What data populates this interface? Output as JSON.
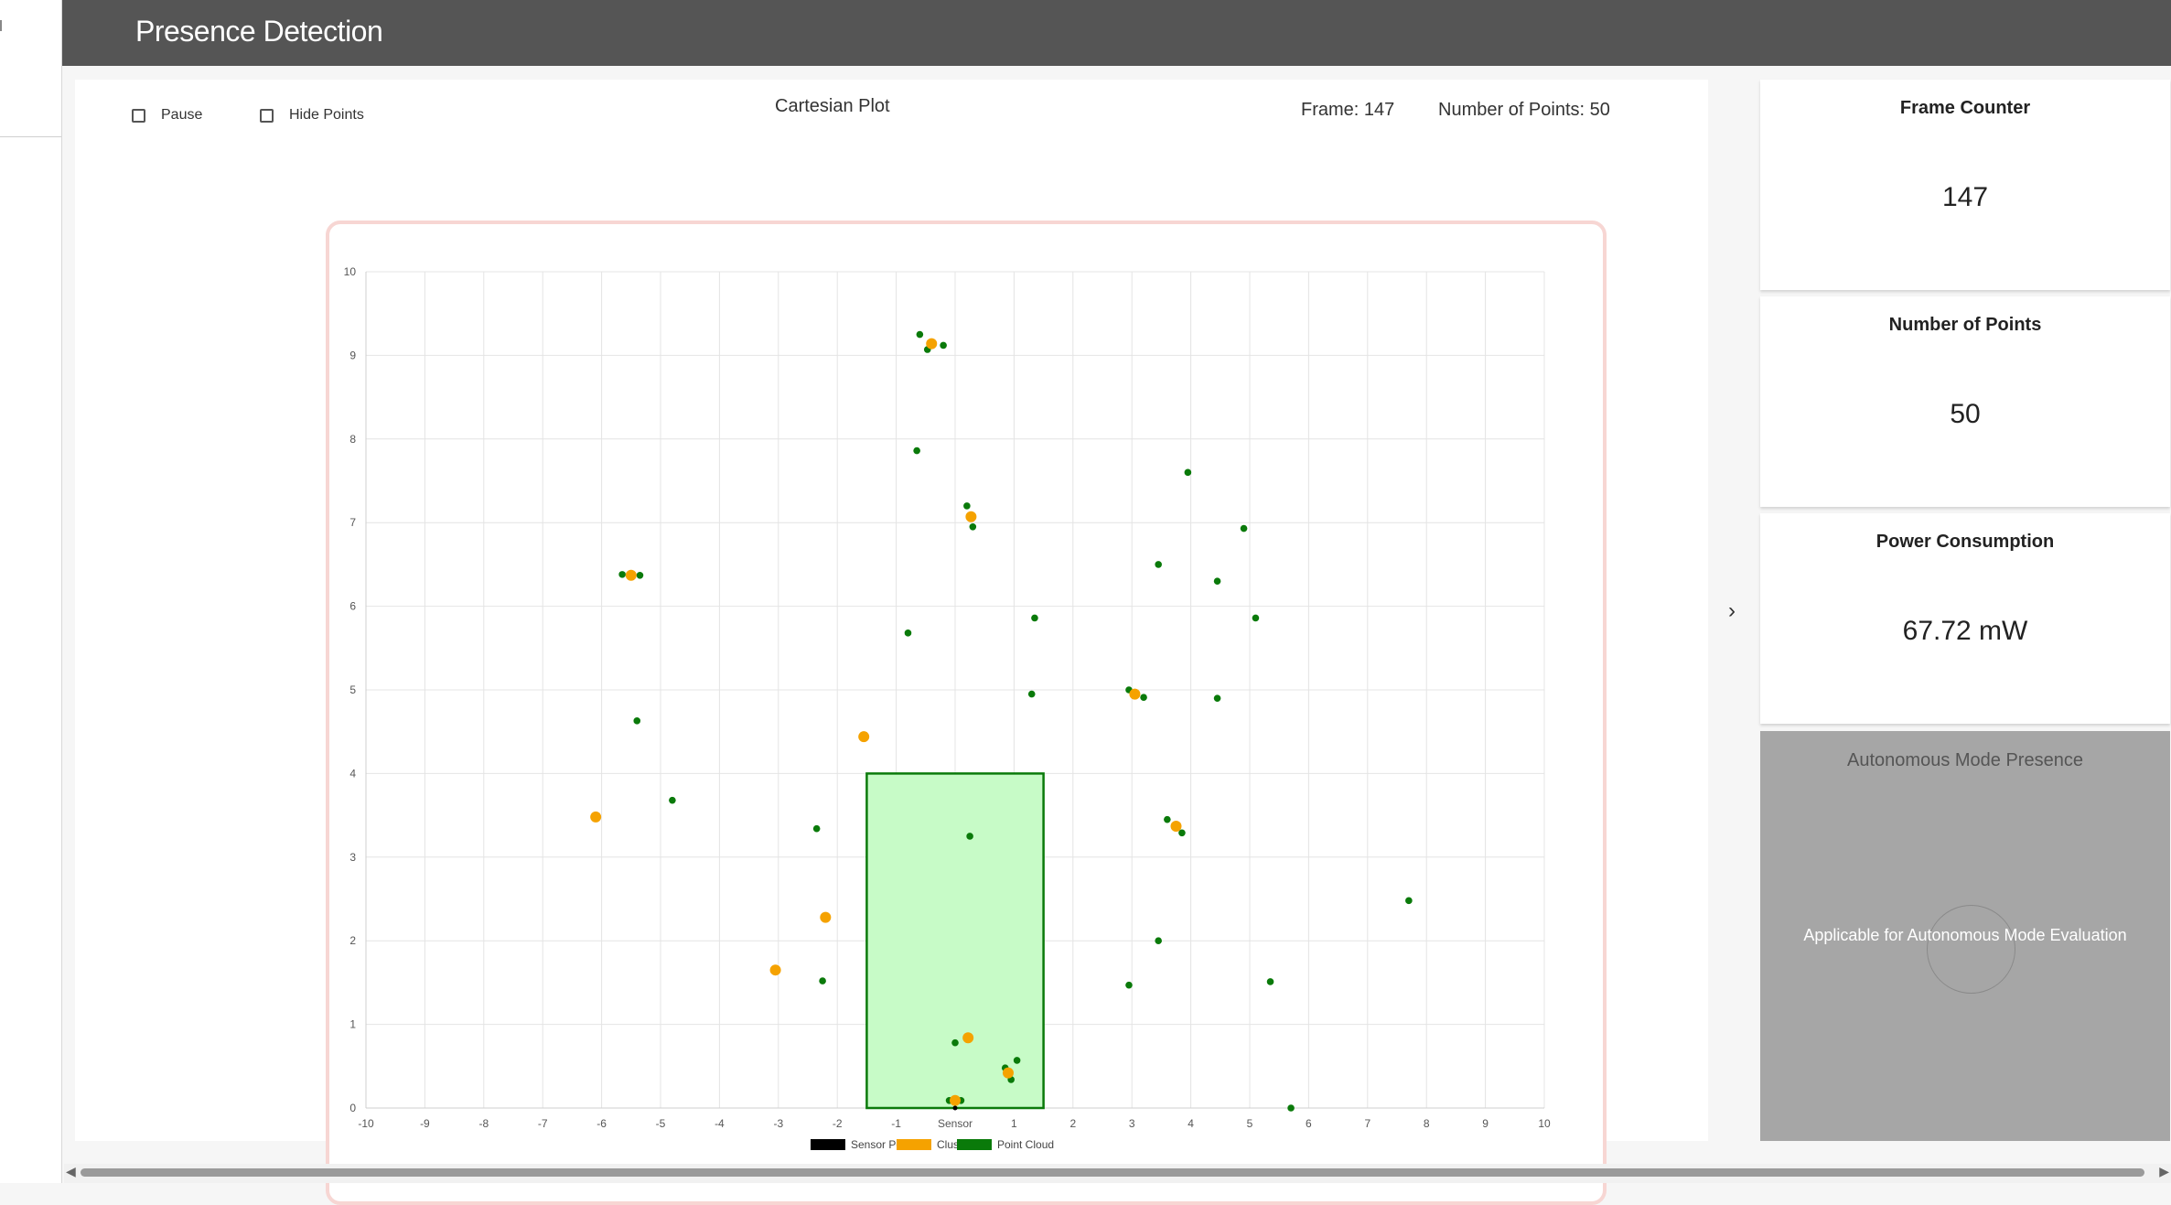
{
  "app": {
    "title": "Presence Detection"
  },
  "controls": {
    "pause_label": "Pause",
    "hide_points_label": "Hide Points"
  },
  "plot": {
    "title": "Cartesian Plot",
    "frame_text": "Frame: 147",
    "points_text": "Number of Points: 50"
  },
  "side": {
    "frame_counter": {
      "title": "Frame Counter",
      "value": "147"
    },
    "num_points": {
      "title": "Number of Points",
      "value": "50"
    },
    "power": {
      "title": "Power Consumption",
      "value": "67.72 mW"
    },
    "autonomous": {
      "title": "Autonomous Mode Presence",
      "text": "Applicable for Autonomous Mode Evaluation",
      "color": "#a6a6a6"
    }
  },
  "icons": {
    "toggle": "chevron-right-icon"
  },
  "chart_data": {
    "type": "scatter",
    "title": "Cartesian Plot",
    "xlim": [
      -10,
      10
    ],
    "ylim": [
      0,
      10
    ],
    "x_ticks": [
      "-10",
      "-9",
      "-8",
      "-7",
      "-6",
      "-5",
      "-4",
      "-3",
      "-2",
      "-1",
      "Sensor",
      "1",
      "2",
      "3",
      "4",
      "5",
      "6",
      "7",
      "8",
      "9",
      "10"
    ],
    "y_ticks": [
      "0",
      "1",
      "2",
      "3",
      "4",
      "5",
      "6",
      "7",
      "8",
      "9",
      "10"
    ],
    "grid": true,
    "legend": [
      "Sensor Position",
      "Clusters",
      "Point Cloud"
    ],
    "colors": {
      "sensor": "#000000",
      "clusters": "#f5a200",
      "points": "#0a7a0a",
      "zone_fill": "#c7fbc7",
      "zone_stroke": "#0a7a0a"
    },
    "zone": {
      "x": [
        -1.5,
        1.5
      ],
      "y": [
        0,
        4
      ]
    },
    "sensor_position": [
      0,
      0
    ],
    "clusters": [
      [
        -0.4,
        9.14
      ],
      [
        0.27,
        7.07
      ],
      [
        -5.5,
        6.37
      ],
      [
        3.05,
        4.95
      ],
      [
        -1.55,
        4.44
      ],
      [
        -6.1,
        3.48
      ],
      [
        3.75,
        3.37
      ],
      [
        -2.2,
        2.28
      ],
      [
        -3.05,
        1.65
      ],
      [
        0.22,
        0.84
      ],
      [
        0.9,
        0.42
      ],
      [
        0.0,
        0.09
      ]
    ],
    "points": [
      [
        -0.6,
        9.25
      ],
      [
        -0.47,
        9.07
      ],
      [
        -0.2,
        9.12
      ],
      [
        -0.65,
        7.86
      ],
      [
        0.2,
        7.2
      ],
      [
        0.3,
        6.95
      ],
      [
        3.95,
        7.6
      ],
      [
        4.9,
        6.93
      ],
      [
        -5.65,
        6.38
      ],
      [
        -5.35,
        6.37
      ],
      [
        3.45,
        6.5
      ],
      [
        4.45,
        6.3
      ],
      [
        -0.8,
        5.68
      ],
      [
        1.35,
        5.86
      ],
      [
        5.1,
        5.86
      ],
      [
        1.3,
        4.95
      ],
      [
        2.95,
        5.0
      ],
      [
        3.2,
        4.91
      ],
      [
        4.45,
        4.9
      ],
      [
        -5.4,
        4.63
      ],
      [
        -4.8,
        3.68
      ],
      [
        -2.35,
        3.34
      ],
      [
        0.25,
        3.25
      ],
      [
        3.6,
        3.45
      ],
      [
        3.85,
        3.29
      ],
      [
        7.7,
        2.48
      ],
      [
        3.45,
        2.0
      ],
      [
        -2.25,
        1.52
      ],
      [
        2.95,
        1.47
      ],
      [
        5.35,
        1.51
      ],
      [
        0.0,
        0.78
      ],
      [
        1.05,
        0.57
      ],
      [
        0.85,
        0.48
      ],
      [
        0.95,
        0.34
      ],
      [
        -0.1,
        0.09
      ],
      [
        0.1,
        0.09
      ],
      [
        5.7,
        0.0
      ]
    ]
  }
}
